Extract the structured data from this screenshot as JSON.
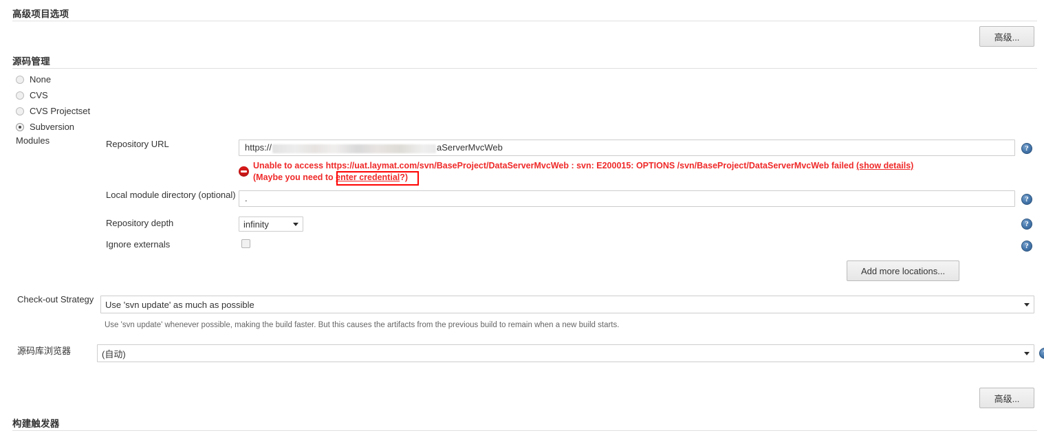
{
  "sections": {
    "advanced_project_options": "高级项目选项",
    "source_code_management": "源码管理",
    "build_triggers": "构建触发器"
  },
  "buttons": {
    "advanced_top": "高级...",
    "advanced_bottom": "高级...",
    "add_more_locations": "Add more locations..."
  },
  "scm": {
    "radios": [
      {
        "label": "None",
        "checked": false
      },
      {
        "label": "CVS",
        "checked": false
      },
      {
        "label": "CVS Projectset",
        "checked": false
      },
      {
        "label": "Subversion",
        "checked": true
      }
    ],
    "modules_label": "Modules",
    "repository_url": {
      "label": "Repository URL",
      "value_prefix": "https://",
      "value_suffix": "aServerMvcWeb",
      "redacted": true
    },
    "error": {
      "line1_before_link": "Unable to access https://uat.laymat.com/svn/BaseProject/DataServerMvcWeb : svn: E200015: OPTIONS /svn/BaseProject/DataServerMvcWeb failed ",
      "line1_link": "(show details)",
      "line2_before_link": "(Maybe you need to ",
      "line2_link": "enter credential",
      "line2_after_link": "?)"
    },
    "local_module_directory": {
      "label": "Local module directory (optional)",
      "value": "."
    },
    "repository_depth": {
      "label": "Repository depth",
      "value": "infinity"
    },
    "ignore_externals": {
      "label": "Ignore externals",
      "checked": false
    }
  },
  "checkout_strategy": {
    "label": "Check-out Strategy",
    "value": "Use 'svn update' as much as possible",
    "help": "Use 'svn update' whenever possible, making the build faster. But this causes the artifacts from the previous build to remain when a new build starts."
  },
  "repository_browser": {
    "label": "源码库浏览器",
    "value": "(自动)"
  },
  "icons": {
    "help": "?"
  },
  "colors": {
    "error_red": "#ef2929",
    "annotation_red": "#ff0000",
    "help_blue": "#2f5d92"
  }
}
